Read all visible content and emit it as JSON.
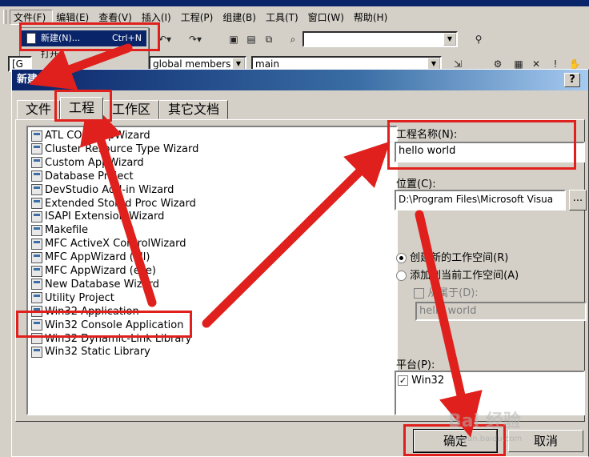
{
  "ide": {
    "menu": [
      "文件(F)",
      "编辑(E)",
      "查看(V)",
      "插入(I)",
      "工程(P)",
      "组建(B)",
      "工具(T)",
      "窗口(W)",
      "帮助(H)"
    ],
    "file_menu": {
      "new_label": "新建(N)...",
      "new_shortcut": "Ctrl+N",
      "open_label": "打开"
    },
    "toolbar2": {
      "class_combo": "global members",
      "func_combo": "main",
      "left_combo": "[G",
      "close_label": "关闭"
    }
  },
  "dialog": {
    "title": "新建",
    "help_label": "?",
    "tabs": [
      "文件",
      "工程",
      "工作区",
      "其它文档"
    ],
    "active_tab": 1,
    "project_types": [
      "ATL COM AppWizard",
      "Cluster Resource Type Wizard",
      "Custom AppWizard",
      "Database Project",
      "DevStudio Add-in Wizard",
      "Extended Stored Proc Wizard",
      "ISAPI Extension Wizard",
      "Makefile",
      "MFC ActiveX ControlWizard",
      "MFC AppWizard (dll)",
      "MFC AppWizard (exe)",
      "New Database Wizard",
      "Utility Project",
      "Win32 Application",
      "Win32 Console Application",
      "Win32 Dynamic-Link Library",
      "Win32 Static Library"
    ],
    "project_name_label": "工程名称(N):",
    "project_name_value": "hello world",
    "location_label": "位置(C):",
    "location_value": "D:\\Program Files\\Microsoft Visua",
    "browse_label": "...",
    "radio_create": "创建新的工作空间(R)",
    "radio_add": "添加到当前工作空间(A)",
    "dependency_label": "从属于(D):",
    "dependency_value": "hello world",
    "platform_label": "平台(P):",
    "platform_item": "Win32",
    "ok_label": "确定",
    "cancel_label": "取消"
  },
  "watermark": {
    "brand": "Bai 经验",
    "url": "jingyan.baidu.com"
  },
  "colors": {
    "annotation_red": "#e0201c",
    "title_blue": "#0a246a",
    "highlight": "#0a246a"
  }
}
